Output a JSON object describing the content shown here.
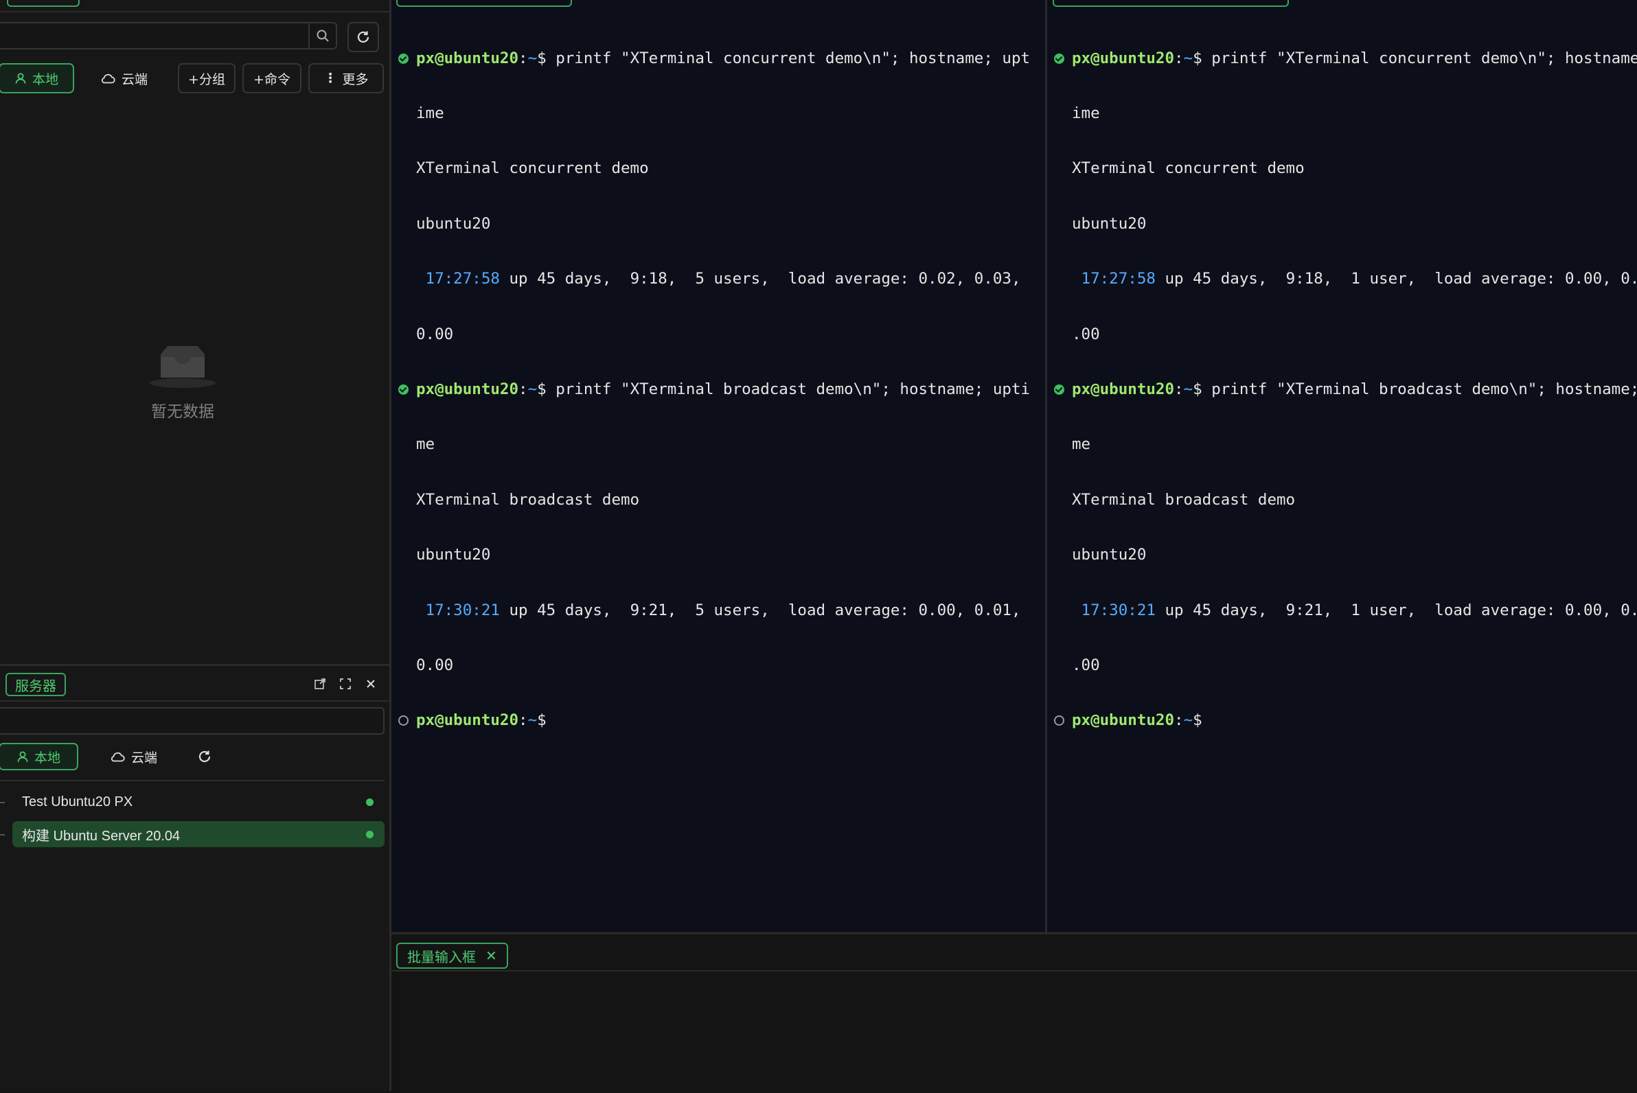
{
  "sidebar": {
    "search": {
      "placeholder": ""
    },
    "tabs": {
      "local": "本地",
      "cloud": "云端"
    },
    "buttons": {
      "add_group": "+分组",
      "add_command": "+命令",
      "more": "更多"
    },
    "empty_text": "暂无数据"
  },
  "server_panel": {
    "title": "服务器",
    "search": {
      "placeholder": ""
    },
    "tabs": {
      "local": "本地",
      "cloud": "云端"
    },
    "servers": [
      {
        "name": "Test Ubuntu20 PX",
        "status": "online"
      },
      {
        "name": "构建 Ubuntu Server 20.04",
        "status": "online"
      }
    ]
  },
  "terminals": [
    {
      "prompt": {
        "user_host": "px@ubuntu20",
        "sep": ":",
        "path": "~",
        "symbol": "$"
      },
      "blocks": [
        {
          "cmd_line1": " printf \"XTerminal concurrent demo\\n\"; hostname; upt",
          "cmd_line2": "ime",
          "out1": "XTerminal concurrent demo",
          "out2": "ubuntu20",
          "time": " 17:27:58",
          "uptime_rest": " up 45 days,  9:18,  5 users,  load average: 0.02, 0.03,",
          "uptime_wrap": "0.00"
        },
        {
          "cmd_line1": " printf \"XTerminal broadcast demo\\n\"; hostname; upti",
          "cmd_line2": "me",
          "out1": "XTerminal broadcast demo",
          "out2": "ubuntu20",
          "time": " 17:30:21",
          "uptime_rest": " up 45 days,  9:21,  5 users,  load average: 0.00, 0.01,",
          "uptime_wrap": "0.00"
        }
      ]
    },
    {
      "prompt": {
        "user_host": "px@ubuntu20",
        "sep": ":",
        "path": "~",
        "symbol": "$"
      },
      "blocks": [
        {
          "cmd_line1": " printf \"XTerminal concurrent demo\\n\"; hostname",
          "cmd_line2": "ime",
          "out1": "XTerminal concurrent demo",
          "out2": "ubuntu20",
          "time": " 17:27:58",
          "uptime_rest": " up 45 days,  9:18,  1 user,  load average: 0.00, 0.0",
          "uptime_wrap": ".00"
        },
        {
          "cmd_line1": " printf \"XTerminal broadcast demo\\n\"; hostname;",
          "cmd_line2": "me",
          "out1": "XTerminal broadcast demo",
          "out2": "ubuntu20",
          "time": " 17:30:21",
          "uptime_rest": " up 45 days,  9:21,  1 user,  load average: 0.00, 0.0",
          "uptime_wrap": ".00"
        }
      ]
    }
  ],
  "batch_input": {
    "tab_label": "批量输入框",
    "close": "✕"
  },
  "colors": {
    "accent": "#3aa35d",
    "terminal_bg": "#0c0f19",
    "prompt_user": "#9fe870",
    "prompt_path": "#5aa9ff",
    "time": "#5aa9ff"
  }
}
